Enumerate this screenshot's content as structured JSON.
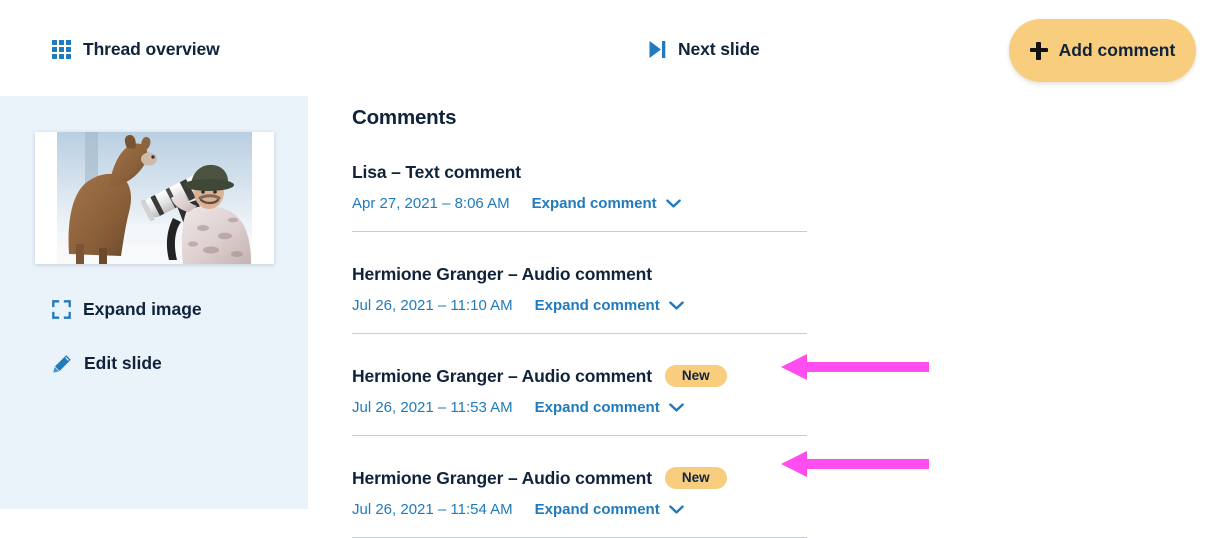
{
  "header": {
    "thread_overview": {
      "label": "Thread overview",
      "icon": "grid-icon"
    },
    "next_slide": {
      "label": "Next slide",
      "icon": "skip-next-icon"
    },
    "add_comment": {
      "label": "Add comment",
      "icon": "plus-icon",
      "color": "#f8cd7d"
    }
  },
  "sidebar": {
    "background": "#eaf2fa",
    "thumbnail_alt": "Photographer in snow camouflage with a deer sniffing his telephoto lens",
    "expand_image": {
      "label": "Expand image",
      "icon": "expand-icon"
    },
    "edit_slide": {
      "label": "Edit slide",
      "icon": "pencil-icon"
    }
  },
  "comments_panel": {
    "title": "Comments",
    "expand_label": "Expand comment",
    "badge_label": "New",
    "link_color": "#1f7bbd",
    "items": [
      {
        "author_line": "Lisa – Text comment",
        "date": "Apr 27, 2021 – 8:06 AM",
        "expand_label": "Expand comment",
        "is_new": false
      },
      {
        "author_line": "Hermione Granger – Audio comment",
        "date": "Jul 26, 2021 – 11:10 AM",
        "expand_label": "Expand comment",
        "is_new": false
      },
      {
        "author_line": "Hermione Granger – Audio comment",
        "date": "Jul 26, 2021 – 11:53 AM",
        "expand_label": "Expand comment",
        "is_new": true,
        "badge_label": "New"
      },
      {
        "author_line": "Hermione Granger – Audio comment",
        "date": "Jul 26, 2021 – 11:54 AM",
        "expand_label": "Expand comment",
        "is_new": true,
        "badge_label": "New"
      }
    ]
  },
  "annotations": {
    "arrow_color": "#ff4df0",
    "arrows": [
      {
        "points_to": "new-badge-comment-3"
      },
      {
        "points_to": "new-badge-comment-4"
      }
    ]
  }
}
